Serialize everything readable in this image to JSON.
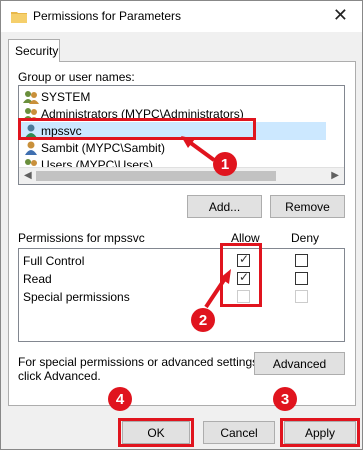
{
  "window": {
    "title": "Permissions for Parameters"
  },
  "tabs": [
    {
      "label": "Security"
    }
  ],
  "group_label": "Group or user names:",
  "users": [
    {
      "name": "SYSTEM"
    },
    {
      "name": "Administrators (MYPC\\Administrators)"
    },
    {
      "name": "mpssvc",
      "selected": true
    },
    {
      "name": "Sambit (MYPC\\Sambit)"
    },
    {
      "name": "Users (MYPC\\Users)"
    }
  ],
  "buttons": {
    "add": "Add...",
    "remove": "Remove",
    "advanced": "Advanced",
    "ok": "OK",
    "cancel": "Cancel",
    "apply": "Apply"
  },
  "permissions": {
    "header": "Permissions for mpssvc",
    "allow_label": "Allow",
    "deny_label": "Deny",
    "rows": [
      {
        "name": "Full Control",
        "allow": true,
        "deny": false,
        "enabled": true
      },
      {
        "name": "Read",
        "allow": true,
        "deny": false,
        "enabled": true
      },
      {
        "name": "Special permissions",
        "allow": false,
        "deny": false,
        "enabled": false
      }
    ]
  },
  "advanced_text": {
    "line1": "For special permissions or advanced settings,",
    "line2": "click Advanced."
  },
  "annotations": [
    {
      "number": "1"
    },
    {
      "number": "2"
    },
    {
      "number": "3"
    },
    {
      "number": "4"
    }
  ],
  "colors": {
    "annotation": "#e0141e",
    "selection": "#cce8ff",
    "window_bg": "#f0f0f0"
  }
}
